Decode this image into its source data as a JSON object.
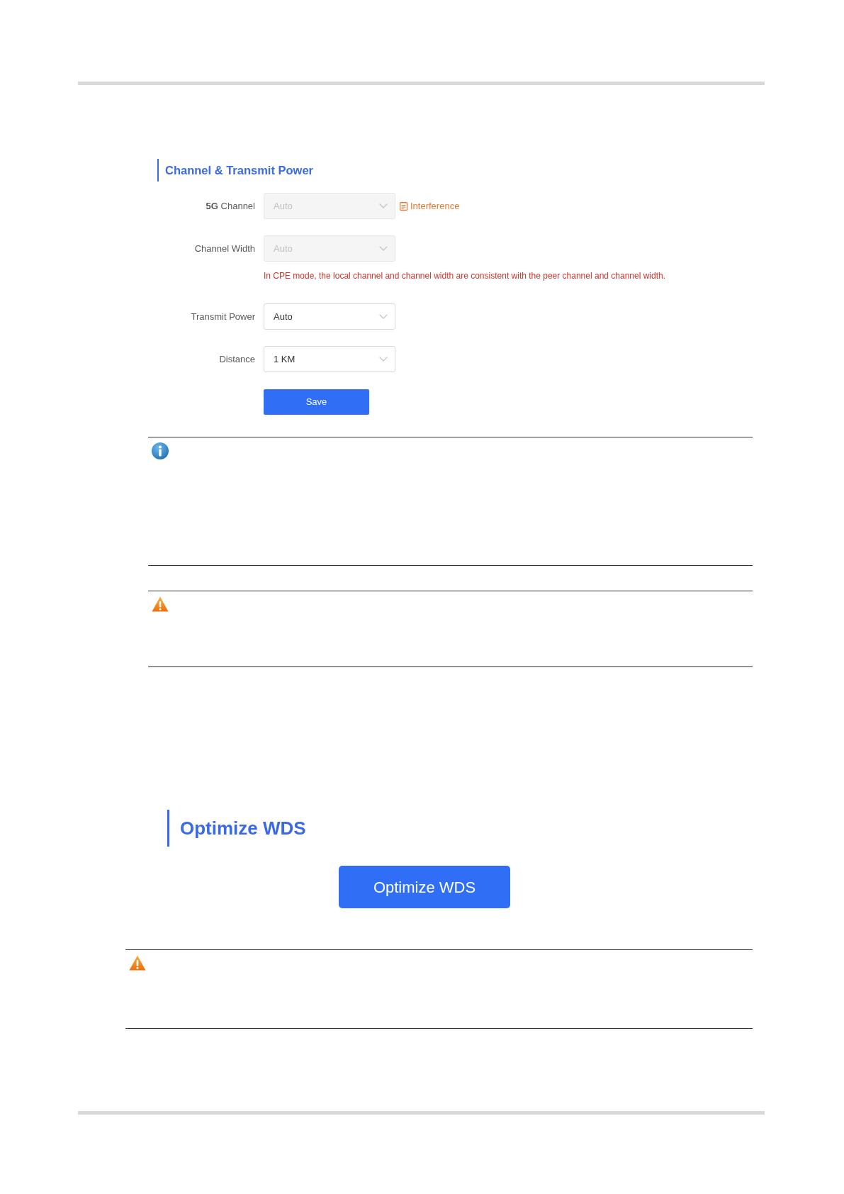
{
  "channel_section": {
    "title": "Channel & Transmit Power",
    "fields": [
      {
        "label": "**5G** Channel",
        "value": "Auto",
        "disabled": true,
        "link": "Interference"
      },
      {
        "label": "Channel Width",
        "value": "Auto",
        "disabled": true,
        "hint": "In CPE mode, the local channel and channel width are consistent with the peer channel and channel width."
      },
      {
        "label": "Transmit Power",
        "value": "Auto",
        "disabled": false
      },
      {
        "label": "Distance",
        "value": "1 KM",
        "disabled": false
      }
    ],
    "save_button": "Save"
  },
  "channel_notes": [
    {
      "kind": "info"
    },
    {
      "kind": "warning"
    }
  ],
  "wds_section": {
    "title": "Optimize WDS",
    "button": "Optimize WDS"
  },
  "wds_notes": [
    {
      "kind": "warning"
    }
  ]
}
